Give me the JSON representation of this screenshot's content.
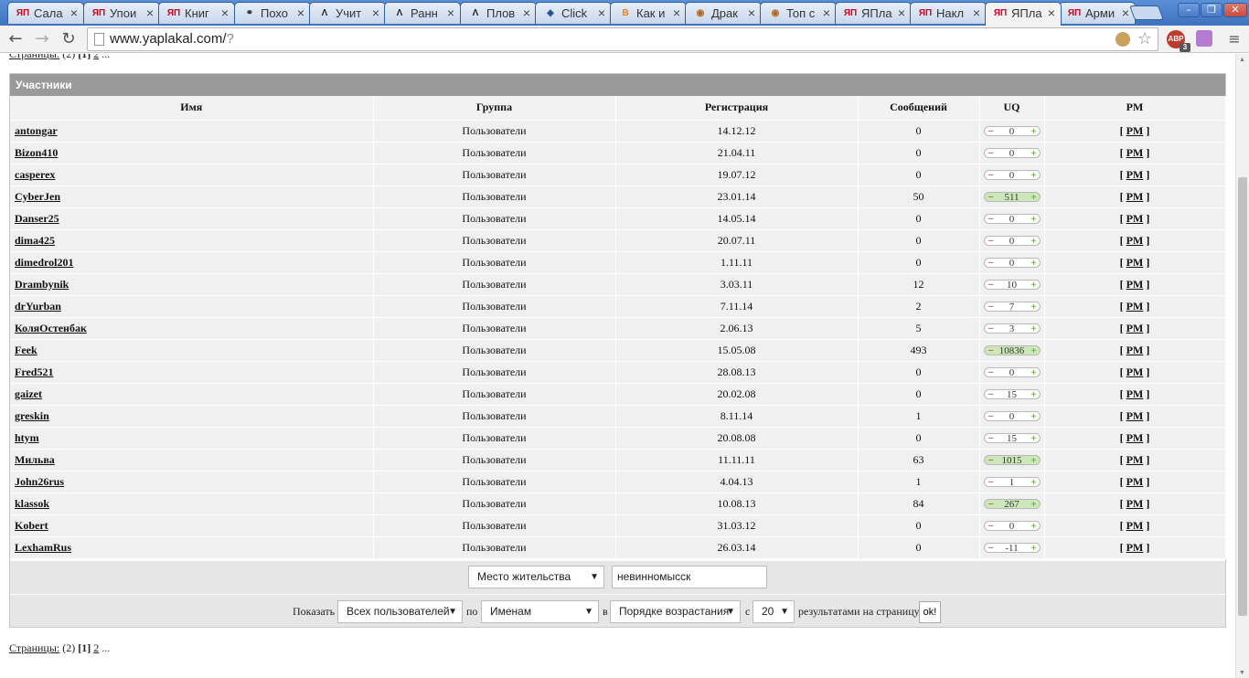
{
  "browser": {
    "tabs": [
      {
        "icon": "ЯП",
        "title": "Сала"
      },
      {
        "icon": "ЯП",
        "title": "Упои"
      },
      {
        "icon": "ЯП",
        "title": "Книг"
      },
      {
        "icon": "⚭",
        "title": "Похо"
      },
      {
        "icon": "Λ",
        "title": "Учит"
      },
      {
        "icon": "Λ",
        "title": "Ранн"
      },
      {
        "icon": "Λ",
        "title": "Плов"
      },
      {
        "icon": "◈",
        "title": "Click"
      },
      {
        "icon": "B",
        "title": "Как и"
      },
      {
        "icon": "◉",
        "title": "Драк"
      },
      {
        "icon": "◉",
        "title": "Топ с"
      },
      {
        "icon": "ЯП",
        "title": "ЯПла"
      },
      {
        "icon": "ЯП",
        "title": "Накл"
      },
      {
        "icon": "ЯП",
        "title": "ЯПла"
      },
      {
        "icon": "ЯП",
        "title": "Арми"
      }
    ],
    "active_tab": 13,
    "url_host": "www.yaplakal.com/",
    "url_path": "?",
    "abp_label": "ABP",
    "abp_count": "3"
  },
  "pagination": {
    "label": "Страницы:",
    "total": "(2)",
    "current": "[1]",
    "next": "2",
    "more": "..."
  },
  "panel": {
    "title": "Участники",
    "columns": {
      "name": "Имя",
      "group": "Группа",
      "registered": "Регистрация",
      "posts": "Сообщений",
      "uq": "UQ",
      "pm": "PM"
    },
    "rows": [
      {
        "name": "antongar",
        "group": "Пользователи",
        "registered": "14.12.12",
        "posts": "0",
        "uq": "0",
        "uq_positive": false
      },
      {
        "name": "Bizon410",
        "group": "Пользователи",
        "registered": "21.04.11",
        "posts": "0",
        "uq": "0",
        "uq_positive": false
      },
      {
        "name": "casperex",
        "group": "Пользователи",
        "registered": "19.07.12",
        "posts": "0",
        "uq": "0",
        "uq_positive": false
      },
      {
        "name": "CyberJen",
        "group": "Пользователи",
        "registered": "23.01.14",
        "posts": "50",
        "uq": "511",
        "uq_positive": true
      },
      {
        "name": "Danser25",
        "group": "Пользователи",
        "registered": "14.05.14",
        "posts": "0",
        "uq": "0",
        "uq_positive": false
      },
      {
        "name": "dima425",
        "group": "Пользователи",
        "registered": "20.07.11",
        "posts": "0",
        "uq": "0",
        "uq_positive": false
      },
      {
        "name": "dimedrol201",
        "group": "Пользователи",
        "registered": "1.11.11",
        "posts": "0",
        "uq": "0",
        "uq_positive": false
      },
      {
        "name": "Drambynik",
        "group": "Пользователи",
        "registered": "3.03.11",
        "posts": "12",
        "uq": "10",
        "uq_positive": false
      },
      {
        "name": "drYurban",
        "group": "Пользователи",
        "registered": "7.11.14",
        "posts": "2",
        "uq": "7",
        "uq_positive": false
      },
      {
        "name": "КоляОстенбак",
        "group": "Пользователи",
        "registered": "2.06.13",
        "posts": "5",
        "uq": "3",
        "uq_positive": false
      },
      {
        "name": "Feek",
        "group": "Пользователи",
        "registered": "15.05.08",
        "posts": "493",
        "uq": "10836",
        "uq_positive": true
      },
      {
        "name": "Fred521",
        "group": "Пользователи",
        "registered": "28.08.13",
        "posts": "0",
        "uq": "0",
        "uq_positive": false
      },
      {
        "name": "gaizet",
        "group": "Пользователи",
        "registered": "20.02.08",
        "posts": "0",
        "uq": "15",
        "uq_positive": false
      },
      {
        "name": "greskin",
        "group": "Пользователи",
        "registered": "8.11.14",
        "posts": "1",
        "uq": "0",
        "uq_positive": false
      },
      {
        "name": "htym",
        "group": "Пользователи",
        "registered": "20.08.08",
        "posts": "0",
        "uq": "15",
        "uq_positive": false
      },
      {
        "name": "Мильва",
        "group": "Пользователи",
        "registered": "11.11.11",
        "posts": "63",
        "uq": "1015",
        "uq_positive": true
      },
      {
        "name": "John26rus",
        "group": "Пользователи",
        "registered": "4.04.13",
        "posts": "1",
        "uq": "1",
        "uq_positive": false
      },
      {
        "name": "klassok",
        "group": "Пользователи",
        "registered": "10.08.13",
        "posts": "84",
        "uq": "267",
        "uq_positive": true
      },
      {
        "name": "Kobert",
        "group": "Пользователи",
        "registered": "31.03.12",
        "posts": "0",
        "uq": "0",
        "uq_positive": false
      },
      {
        "name": "LexhamRus",
        "group": "Пользователи",
        "registered": "26.03.14",
        "posts": "0",
        "uq": "-11",
        "uq_positive": false
      }
    ],
    "uq_minus": "−",
    "uq_plus": "+",
    "pm_label": "PM"
  },
  "search": {
    "field_select": "Место жительства",
    "field_value": "невинномысск"
  },
  "display": {
    "show_label": "Показать",
    "show_select": "Всех пользователей",
    "by_label": "по",
    "by_select": "Именам",
    "in_label": "в",
    "order_select": "Порядке возрастания",
    "with_label": "с",
    "count_select": "20",
    "results_label": "результатами на страницу",
    "ok_label": "ok!"
  },
  "colors": {
    "tabstrip": "#3f72bf",
    "panel_header": "#9a9a9a",
    "row_bg": "#f0f0f0",
    "uq_positive": "#cde8b8"
  }
}
